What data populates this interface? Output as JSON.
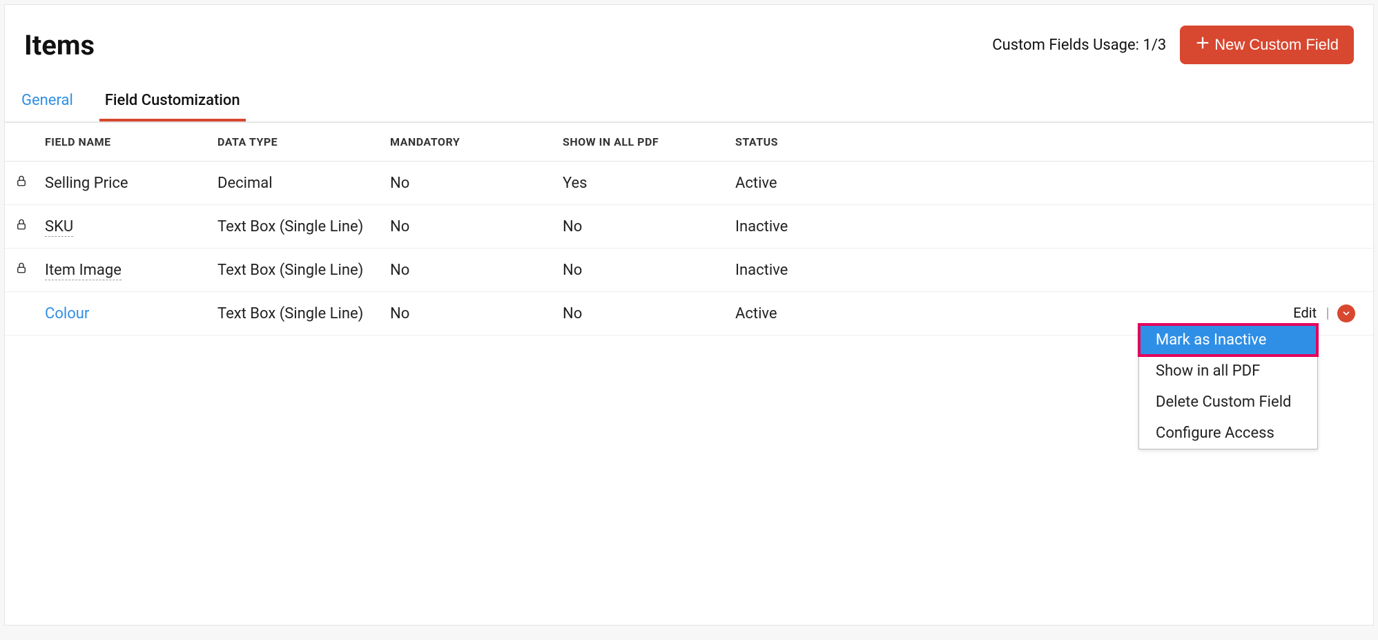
{
  "header": {
    "title": "Items",
    "usage": "Custom Fields Usage: 1/3",
    "new_button": "New Custom Field"
  },
  "tabs": {
    "general": "General",
    "field_customization": "Field Customization"
  },
  "table": {
    "headers": {
      "field_name": "FIELD NAME",
      "data_type": "DATA TYPE",
      "mandatory": "MANDATORY",
      "show_pdf": "SHOW IN ALL PDF",
      "status": "STATUS"
    },
    "rows": [
      {
        "locked": true,
        "name": "Selling Price",
        "type": "Decimal",
        "mandatory": "No",
        "pdf": "Yes",
        "status": "Active",
        "dotted": false
      },
      {
        "locked": true,
        "name": "SKU",
        "type": "Text Box (Single Line)",
        "mandatory": "No",
        "pdf": "No",
        "status": "Inactive",
        "dotted": true
      },
      {
        "locked": true,
        "name": "Item Image",
        "type": "Text Box (Single Line)",
        "mandatory": "No",
        "pdf": "No",
        "status": "Inactive",
        "dotted": true
      },
      {
        "locked": false,
        "name": "Colour",
        "type": "Text Box (Single Line)",
        "mandatory": "No",
        "pdf": "No",
        "status": "Active",
        "dotted": false
      }
    ],
    "edit_label": "Edit"
  },
  "dropdown": {
    "items": [
      "Mark as Inactive",
      "Show in all PDF",
      "Delete Custom Field",
      "Configure Access"
    ]
  }
}
